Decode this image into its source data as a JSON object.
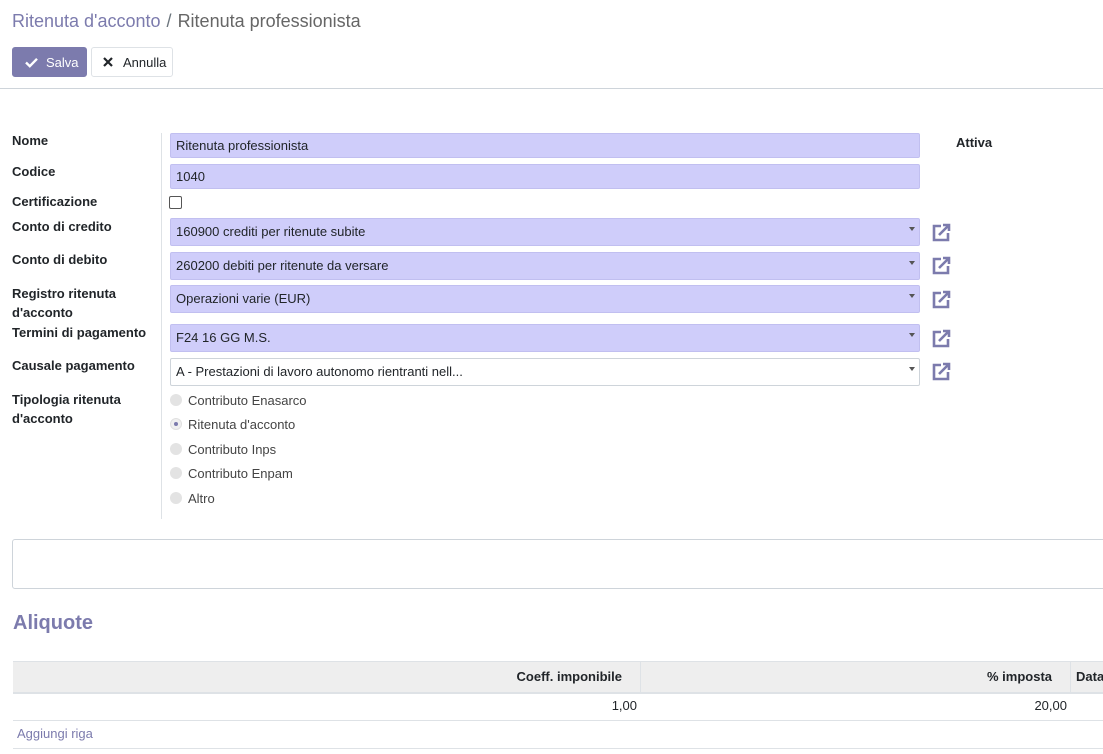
{
  "breadcrumb": {
    "parent": "Ritenuta d'acconto",
    "separator": "/",
    "current": "Ritenuta professionista"
  },
  "toolbar": {
    "save_label": "Salva",
    "discard_label": "Annulla"
  },
  "form": {
    "labels": {
      "name": "Nome",
      "code": "Codice",
      "certification": "Certificazione",
      "credit_account": "Conto di credito",
      "debit_account": "Conto di debito",
      "journal_line1": "Registro ritenuta",
      "journal_line2": "d'acconto",
      "payment_terms": "Termini di pagamento",
      "payment_reason": "Causale pagamento",
      "type_line1": "Tipologia ritenuta",
      "type_line2": "d'acconto",
      "active": "Attiva"
    },
    "values": {
      "name": "Ritenuta professionista",
      "code": "1040",
      "certification_checked": false,
      "credit_account": "160900 crediti per ritenute subite",
      "debit_account": "260200 debiti per ritenute da versare",
      "journal": "Operazioni varie (EUR)",
      "payment_terms": "F24 16 GG M.S.",
      "payment_reason": "A - Prestazioni di lavoro autonomo rientranti nell..."
    },
    "withholding_types": [
      {
        "label": "Contributo Enasarco",
        "checked": false
      },
      {
        "label": "Ritenuta d'acconto",
        "checked": true
      },
      {
        "label": "Contributo Inps",
        "checked": false
      },
      {
        "label": "Contributo Enpam",
        "checked": false
      },
      {
        "label": "Altro",
        "checked": false
      }
    ]
  },
  "rates": {
    "title": "Aliquote",
    "columns": {
      "coeff": "Coeff. imponibile",
      "tax": "% imposta",
      "date": "Data"
    },
    "rows": [
      {
        "coeff": "1,00",
        "tax": "20,00"
      }
    ],
    "add_line": "Aggiungi riga"
  },
  "colors": {
    "accent": "#7c7bad",
    "field_bg": "#cfcdfa"
  },
  "icons": {
    "save": "check-icon",
    "discard": "close-icon",
    "external": "external-link-icon"
  }
}
